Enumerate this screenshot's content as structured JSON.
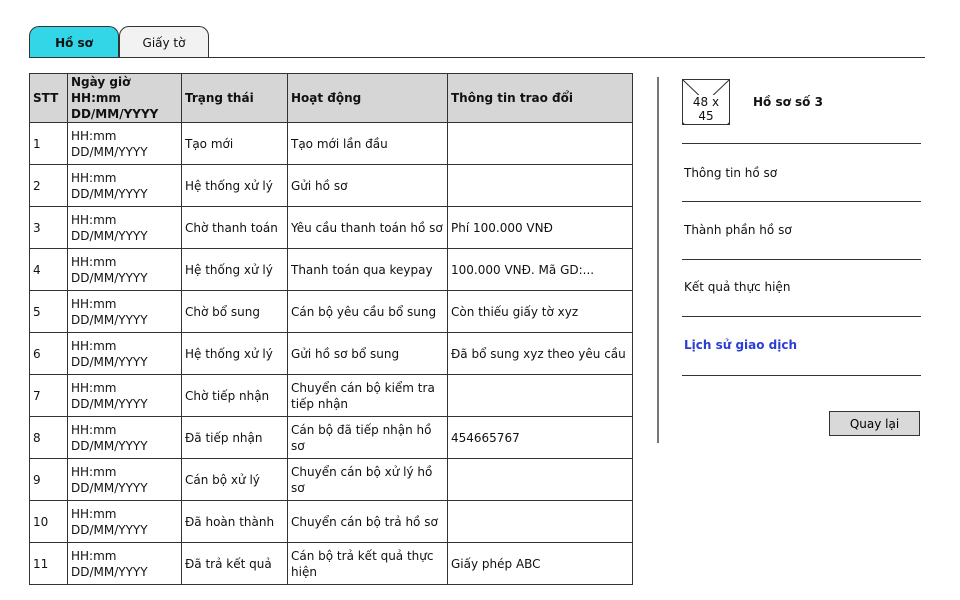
{
  "tabs": [
    {
      "label": "Hồ sơ"
    },
    {
      "label": "Giấy tờ"
    }
  ],
  "table": {
    "headers": {
      "stt": "STT",
      "time": "Ngày giờ HH:mm DD/MM/YYYY",
      "status": "Trạng thái",
      "activity": "Hoạt động",
      "info": "Thông tin trao đổi"
    },
    "rows": [
      {
        "stt": "1",
        "time_a": "HH:mm",
        "time_b": "DD/MM/YYYY",
        "status": "Tạo mới",
        "activity": "Tạo mới lần đầu",
        "info": ""
      },
      {
        "stt": "2",
        "time_a": "HH:mm",
        "time_b": "DD/MM/YYYY",
        "status": "Hệ thống xử lý",
        "activity": "Gửi hồ sơ",
        "info": ""
      },
      {
        "stt": "3",
        "time_a": "HH:mm",
        "time_b": "DD/MM/YYYY",
        "status": "Chờ thanh toán",
        "activity": "Yêu cầu thanh toán hồ sơ",
        "info": "Phí 100.000 VNĐ"
      },
      {
        "stt": "4",
        "time_a": "HH:mm",
        "time_b": "DD/MM/YYYY",
        "status": "Hệ thống xử lý",
        "activity": "Thanh toán qua keypay",
        "info": "100.000 VNĐ. Mã GD:..."
      },
      {
        "stt": "5",
        "time_a": "HH:mm",
        "time_b": "DD/MM/YYYY",
        "status": "Chờ bổ sung",
        "activity": "Cán bộ yêu cầu bổ sung",
        "info": "Còn thiếu giấy tờ xyz"
      },
      {
        "stt": "6",
        "time_a": "HH:mm",
        "time_b": "DD/MM/YYYY",
        "status": "Hệ thống xử lý",
        "activity": "Gửi hồ sơ bổ sung",
        "info": "Đã bổ sung xyz theo yêu cầu"
      },
      {
        "stt": "7",
        "time_a": "HH:mm",
        "time_b": "DD/MM/YYYY",
        "status": "Chờ tiếp nhận",
        "activity": "Chuyển cán bộ kiểm tra tiếp nhận",
        "info": ""
      },
      {
        "stt": "8",
        "time_a": "HH:mm",
        "time_b": "DD/MM/YYYY",
        "status": "Đã tiếp nhận",
        "activity": "Cán bộ đã tiếp nhận hồ sơ",
        "info": "454665767"
      },
      {
        "stt": "9",
        "time_a": "HH:mm",
        "time_b": "DD/MM/YYYY",
        "status": "Cán bộ xử lý",
        "activity": "Chuyển cán bộ xử lý hồ sơ",
        "info": ""
      },
      {
        "stt": "10",
        "time_a": "HH:mm",
        "time_b": "DD/MM/YYYY",
        "status": "Đã hoàn thành",
        "activity": "Chuyển cán bộ trả hồ sơ",
        "info": ""
      },
      {
        "stt": "11",
        "time_a": "HH:mm",
        "time_b": "DD/MM/YYYY",
        "status": "Đã trả kết quả",
        "activity": "Cán bộ trả kết quả thực hiện",
        "info": "Giấy phép ABC"
      }
    ]
  },
  "sidebar": {
    "image_placeholder": "48 x 45",
    "title": "Hồ sơ số 3",
    "items": [
      {
        "label": "Thông tin hồ sơ"
      },
      {
        "label": "Thành phần hồ sơ"
      },
      {
        "label": "Kết quả thực hiện"
      },
      {
        "label": "Lịch sử giao dịch"
      }
    ],
    "back_button": "Quay lại"
  },
  "colors": {
    "active_tab": "#33d6e6",
    "header_bg": "#d6d6d6",
    "active_link": "#2b3fd6",
    "button_bg": "#d9d9d9"
  }
}
